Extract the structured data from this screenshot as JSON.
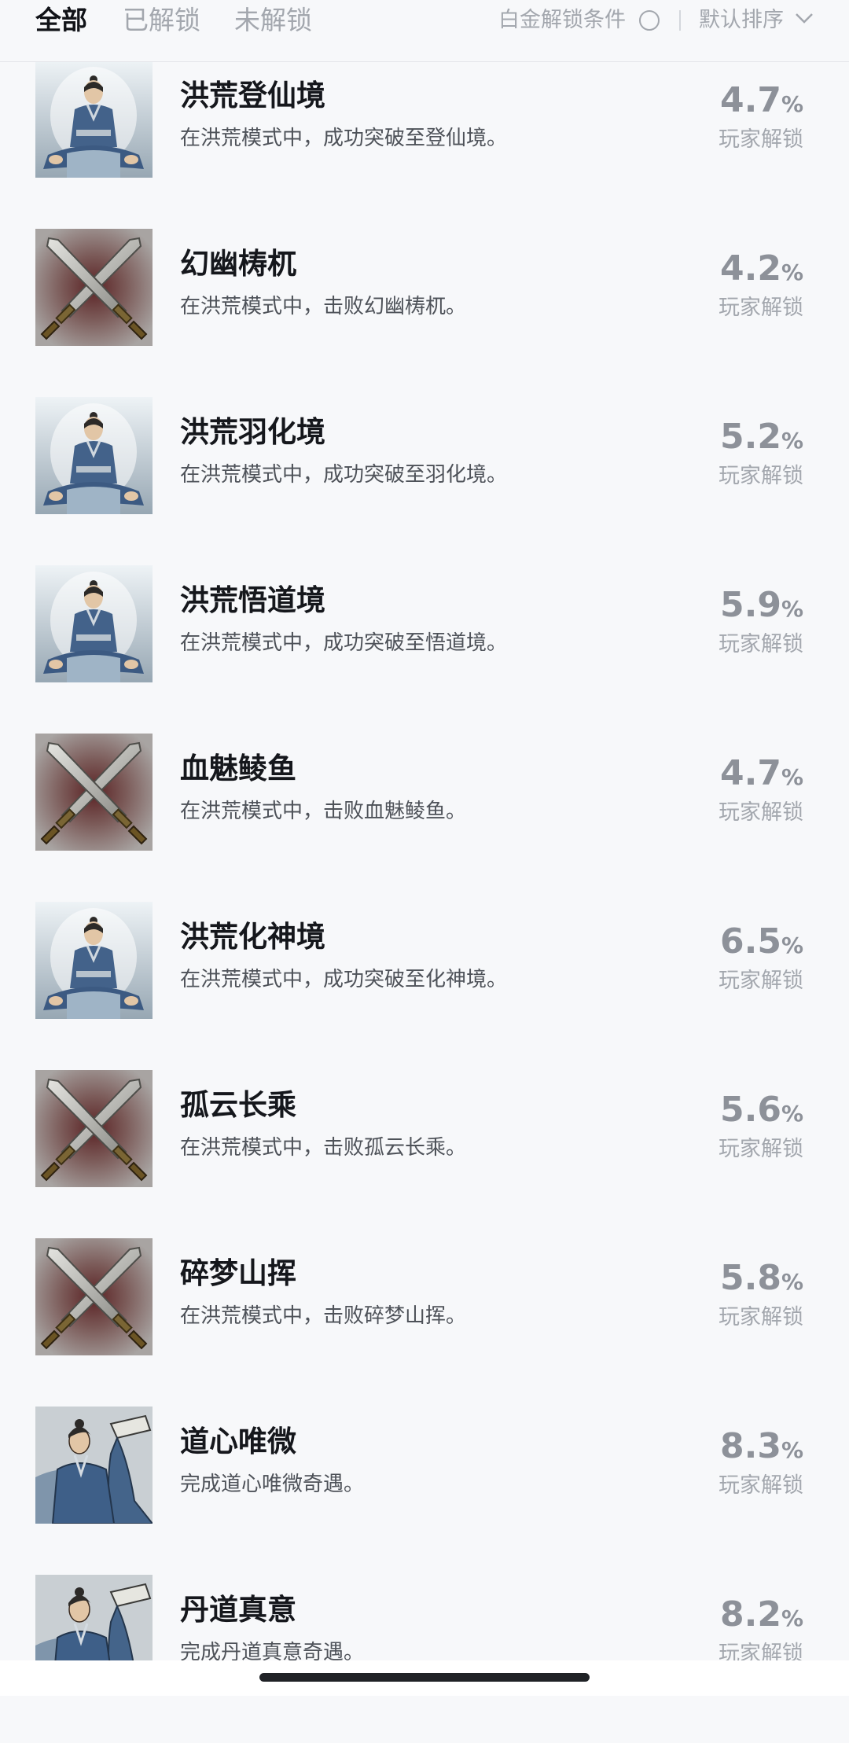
{
  "tabs": [
    {
      "label": "全部",
      "active": true
    },
    {
      "label": "已解锁",
      "active": false
    },
    {
      "label": "未解锁",
      "active": false
    }
  ],
  "platinum_label": "白金解锁条件",
  "sort_label": "默认排序",
  "unlock_suffix": "玩家解锁",
  "percent_sign": "%",
  "icons": {
    "meditation": "meditating-monk-icon",
    "swords": "crossed-swords-icon",
    "cultivator": "cultivator-with-scroll-icon"
  },
  "achievements": [
    {
      "title": "洪荒登仙境",
      "desc": "在洪荒模式中，成功突破至登仙境。",
      "percent": "4.7",
      "icon": "meditation"
    },
    {
      "title": "幻幽梼杌",
      "desc": "在洪荒模式中，击败幻幽梼杌。",
      "percent": "4.2",
      "icon": "swords"
    },
    {
      "title": "洪荒羽化境",
      "desc": "在洪荒模式中，成功突破至羽化境。",
      "percent": "5.2",
      "icon": "meditation"
    },
    {
      "title": "洪荒悟道境",
      "desc": "在洪荒模式中，成功突破至悟道境。",
      "percent": "5.9",
      "icon": "meditation"
    },
    {
      "title": "血魅鲮鱼",
      "desc": "在洪荒模式中，击败血魅鲮鱼。",
      "percent": "4.7",
      "icon": "swords"
    },
    {
      "title": "洪荒化神境",
      "desc": "在洪荒模式中，成功突破至化神境。",
      "percent": "6.5",
      "icon": "meditation"
    },
    {
      "title": "孤云长乘",
      "desc": "在洪荒模式中，击败孤云长乘。",
      "percent": "5.6",
      "icon": "swords"
    },
    {
      "title": "碎梦山挥",
      "desc": "在洪荒模式中，击败碎梦山挥。",
      "percent": "5.8",
      "icon": "swords"
    },
    {
      "title": "道心唯微",
      "desc": "完成道心唯微奇遇。",
      "percent": "8.3",
      "icon": "cultivator"
    },
    {
      "title": "丹道真意",
      "desc": "完成丹道真意奇遇。",
      "percent": "8.2",
      "icon": "cultivator"
    }
  ]
}
